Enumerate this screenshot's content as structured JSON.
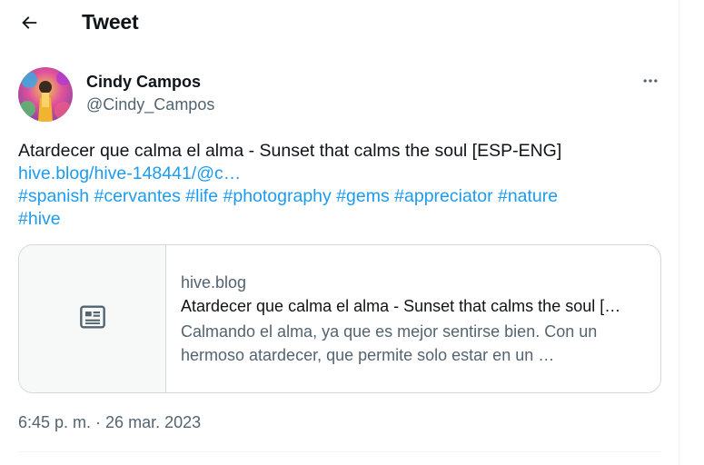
{
  "header": {
    "title": "Tweet",
    "back_icon": "arrow-left-icon"
  },
  "author": {
    "name": "Cindy Campos",
    "handle": "@Cindy_Campos",
    "avatar_icon": "user-avatar"
  },
  "more_icon": "more-horizontal-icon",
  "tweet": {
    "text": "Atardecer que calma el alma - Sunset that calms the soul [ESP-ENG]",
    "link": "hive.blog/hive-148441/@c…",
    "hashtags_line1": [
      "#spanish",
      "#cervantes",
      "#life",
      "#photography",
      "#gems",
      "#appreciator",
      "#nature"
    ],
    "hashtags_line2": [
      "#hive"
    ]
  },
  "card": {
    "thumb_icon": "article-icon",
    "domain": "hive.blog",
    "title": "Atardecer que calma el alma - Sunset that calms the soul […",
    "description_line1": "Calmando el alma, ya que es mejor sentirse bien. Con un",
    "description_line2": "hermoso atardecer, que permite solo estar en un …"
  },
  "timestamp": {
    "time": "6:45 p. m.",
    "separator": " · ",
    "date": "26 mar. 2023"
  },
  "colors": {
    "link": "#1d9bf0",
    "secondary_text": "#536471",
    "primary_text": "#0f1419",
    "border": "#cfd9de"
  }
}
